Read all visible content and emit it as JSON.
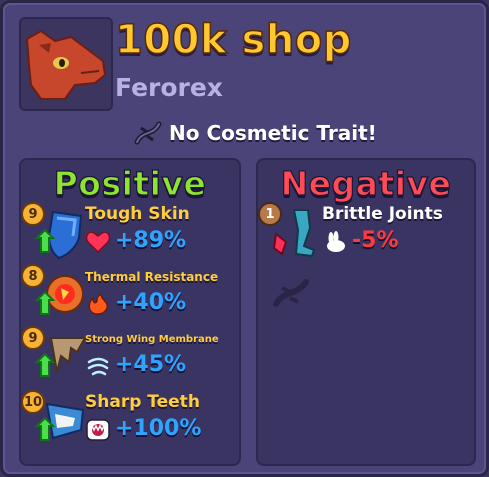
{
  "header": {
    "title": "100k shop",
    "creature_name": "Ferorex",
    "cosmetic_trait": "No Cosmetic Trait!"
  },
  "positive": {
    "title": "Positive",
    "traits": [
      {
        "level": "9",
        "name": "Tough Skin",
        "value": "+89%",
        "icon": "shield-icon",
        "stat_icon": "heart-icon"
      },
      {
        "level": "8",
        "name": "Thermal Resistance",
        "value": "+40%",
        "icon": "fire-orb-icon",
        "stat_icon": "fire-icon"
      },
      {
        "level": "9",
        "name": "Strong Wing Membrane",
        "value": "+45%",
        "icon": "wing-icon",
        "stat_icon": "wind-icon"
      },
      {
        "level": "10",
        "name": "Sharp Teeth",
        "value": "+100%",
        "icon": "jaw-icon",
        "stat_icon": "bite-icon"
      }
    ]
  },
  "negative": {
    "title": "Negative",
    "traits": [
      {
        "level": "1",
        "name": "Brittle Joints",
        "value": "-5%",
        "icon": "leg-bone-icon",
        "stat_icon": "rabbit-icon"
      }
    ]
  },
  "colors": {
    "title": "#ffc832",
    "positive_title": "#8fe52e",
    "negative_title": "#ff4b55",
    "positive_value": "#2fa4ff",
    "negative_value": "#ff3a3a",
    "trait_name": "#ffce3a"
  }
}
